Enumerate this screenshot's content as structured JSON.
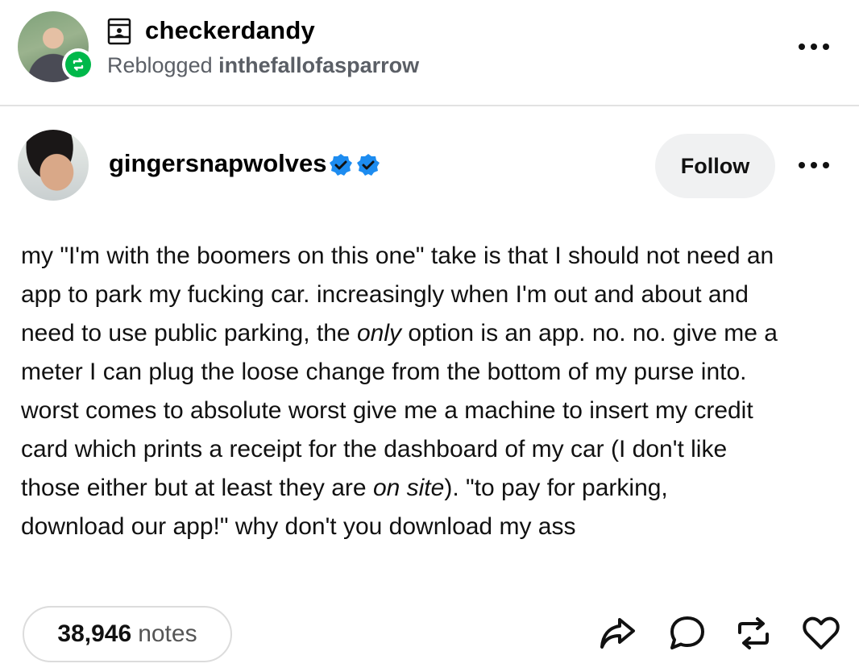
{
  "header": {
    "reblogger_name": "checkerdandy",
    "reblogged_prefix": "Reblogged",
    "reblogged_from": "inthefallofasparrow"
  },
  "author": {
    "name": "gingersnapwolves",
    "follow_label": "Follow"
  },
  "post": {
    "lines": [
      [
        "my \"I'm with the boomers on this one\" take is that I should not need an"
      ],
      [
        "app to park my fucking car. increasingly when I'm out and about and"
      ],
      [
        "need to use public parking, the ",
        {
          "em": "only"
        },
        " option is an app. no. no. give me a"
      ],
      [
        "meter I can plug the loose change from the bottom of my purse into."
      ],
      [
        "worst comes to absolute worst give me a machine to insert my credit"
      ],
      [
        "card which prints a receipt for the dashboard of my car (I don't like"
      ],
      [
        "those either but at least they are ",
        {
          "em": "on site"
        },
        "). \"to pay for parking,"
      ],
      [
        "download our app!\" why don't you download my ass"
      ]
    ]
  },
  "footer": {
    "notes_count": "38,946",
    "notes_label": "notes"
  },
  "icons": [
    "blog-icon",
    "reblog-badge-icon",
    "more-icon",
    "verified-badge-icon",
    "share-icon",
    "reply-icon",
    "reblog-icon",
    "like-icon"
  ],
  "colors": {
    "reblog_green": "#00b84a",
    "verified_blue": "#1d8cf0",
    "muted_text": "#5b5f66",
    "pill_bg": "#f0f1f2"
  }
}
